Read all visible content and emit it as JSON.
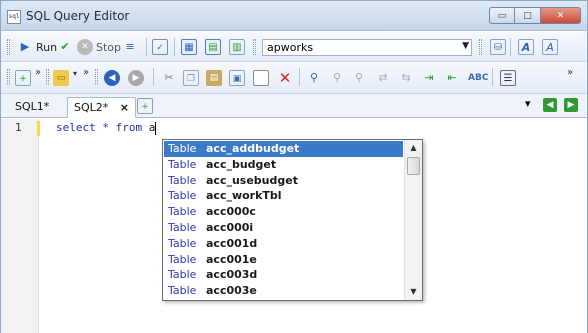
{
  "window": {
    "title": "SQL Query Editor",
    "icon_text": "sql",
    "controls": {
      "minimize": "▭",
      "maximize": "□",
      "close": "✕"
    }
  },
  "toolbar_main": {
    "run_label": "Run",
    "stop_label": "Stop",
    "connection_value": "apworks"
  },
  "tabs": [
    {
      "label": "SQL1*"
    },
    {
      "label": "SQL2*",
      "close": "×"
    }
  ],
  "tab_nav": {
    "menu": "▾",
    "prev": "◀",
    "next": "▶"
  },
  "editor": {
    "line_number": "1",
    "code_text": "select * from ",
    "typed_text": "a"
  },
  "autocomplete": {
    "items": [
      {
        "kind": "Table",
        "name": "acc_addbudget"
      },
      {
        "kind": "Table",
        "name": "acc_budget"
      },
      {
        "kind": "Table",
        "name": "acc_usebudget"
      },
      {
        "kind": "Table",
        "name": "acc_workTbl"
      },
      {
        "kind": "Table",
        "name": "acc000c"
      },
      {
        "kind": "Table",
        "name": "acc000i"
      },
      {
        "kind": "Table",
        "name": "acc001d"
      },
      {
        "kind": "Table",
        "name": "acc001e"
      },
      {
        "kind": "Table",
        "name": "acc003d"
      },
      {
        "kind": "Table",
        "name": "acc003e"
      },
      {
        "kind": "Table",
        "name": ""
      }
    ],
    "selected_index": 0
  },
  "colors": {
    "selection": "#3b79c9",
    "keyword": "#2a2ab0",
    "kind": "#2a3ab8",
    "run_green": "#2f9a2f"
  }
}
